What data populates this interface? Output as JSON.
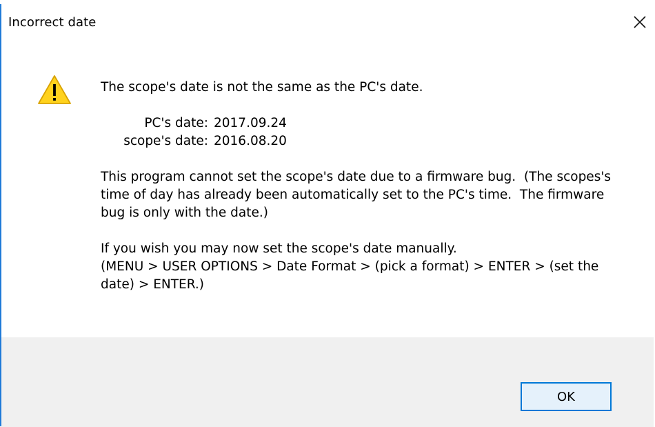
{
  "window": {
    "title": "Incorrect date"
  },
  "icons": {
    "warning": "warning-icon",
    "close": "close-icon"
  },
  "message": {
    "heading": "The scope's date is not the same as the PC's date.",
    "dates": [
      {
        "label": "PC's date:",
        "value": "2017.09.24"
      },
      {
        "label": "scope's date:",
        "value": "2016.08.20"
      }
    ],
    "paragraph1": "This program cannot set the scope's date due to a firmware bug.  (The scopes's time of day has already been automatically set to the PC's time.  The firmware bug is only with the date.)",
    "paragraph2_line1": "If you wish you may now set the scope's date manually.",
    "paragraph2_line2": "(MENU > USER OPTIONS > Date Format > (pick a format) > ENTER > (set the date) > ENTER.)"
  },
  "buttons": {
    "ok_label": "OK"
  },
  "colors": {
    "accent": "#0078d7",
    "warning_fill": "#ffd21e",
    "footer_bg": "#f0f0f0"
  }
}
